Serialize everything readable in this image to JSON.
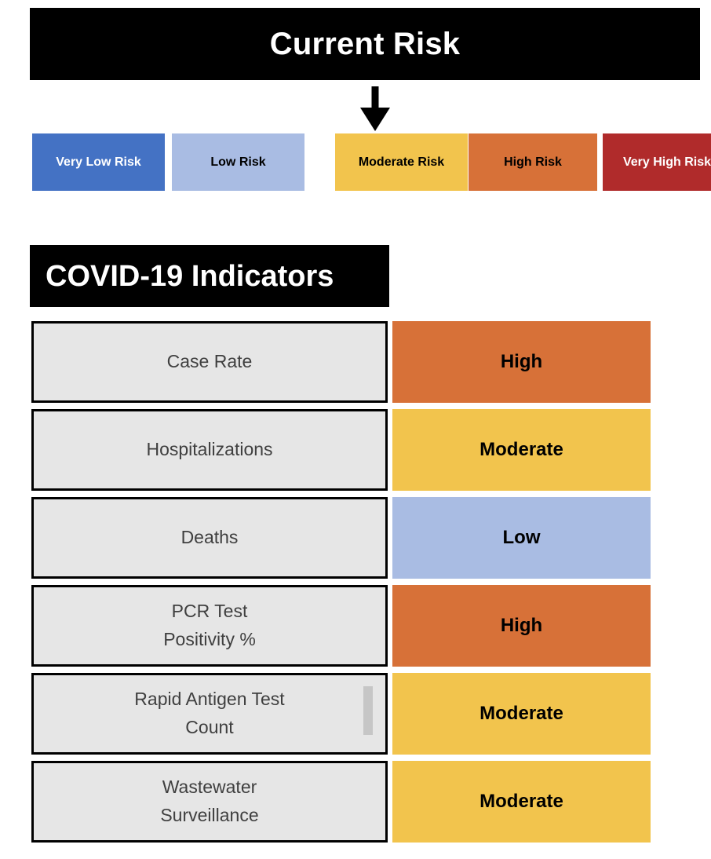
{
  "header": {
    "title": "Current Risk"
  },
  "arrow": {
    "name": "current-risk-pointer",
    "points_to": "Moderate Risk",
    "color": "#000000"
  },
  "risk_scale": {
    "levels": [
      {
        "label": "Very Low Risk",
        "bg": "#4472C4",
        "fg": "#ffffff"
      },
      {
        "label": "Low Risk",
        "bg": "#A9BCE3",
        "fg": "#000000"
      },
      {
        "label": "Moderate Risk",
        "bg": "#F2C44D",
        "fg": "#000000"
      },
      {
        "label": "High Risk",
        "bg": "#D77138",
        "fg": "#000000"
      },
      {
        "label": "Very High Risk",
        "bg": "#B02B２B",
        "fg": "#ffffff"
      }
    ]
  },
  "indicators": {
    "header_title": "COVID-19 Indicators",
    "rows": [
      {
        "name": "Case Rate",
        "status": "High",
        "bg": "#D77138",
        "fg": "#000000",
        "scrollbar": false
      },
      {
        "name": "Hospitalizations",
        "status": "Moderate",
        "bg": "#F2C44D",
        "fg": "#000000",
        "scrollbar": false
      },
      {
        "name": "Deaths",
        "status": "Low",
        "bg": "#A9BCE3",
        "fg": "#000000",
        "scrollbar": false
      },
      {
        "name": "PCR Test\nPositivity %",
        "status": "High",
        "bg": "#D77138",
        "fg": "#000000",
        "scrollbar": false
      },
      {
        "name": "Rapid Antigen Test\nCount",
        "status": "Moderate",
        "bg": "#F2C44D",
        "fg": "#000000",
        "scrollbar": true
      },
      {
        "name": "Wastewater\nSurveillance",
        "status": "Moderate",
        "bg": "#F2C44D",
        "fg": "#000000",
        "scrollbar": false
      }
    ]
  },
  "colors": {
    "very_low": "#4472C4",
    "low": "#A9BCE3",
    "moderate": "#F2C44D",
    "high": "#D77138",
    "very_high": "#B02B2B",
    "cell_bg": "#E6E6E6",
    "cell_border": "#000000",
    "cell_text": "#3F3F3F",
    "bar_bg": "#000000",
    "bar_text": "#FFFFFF"
  }
}
